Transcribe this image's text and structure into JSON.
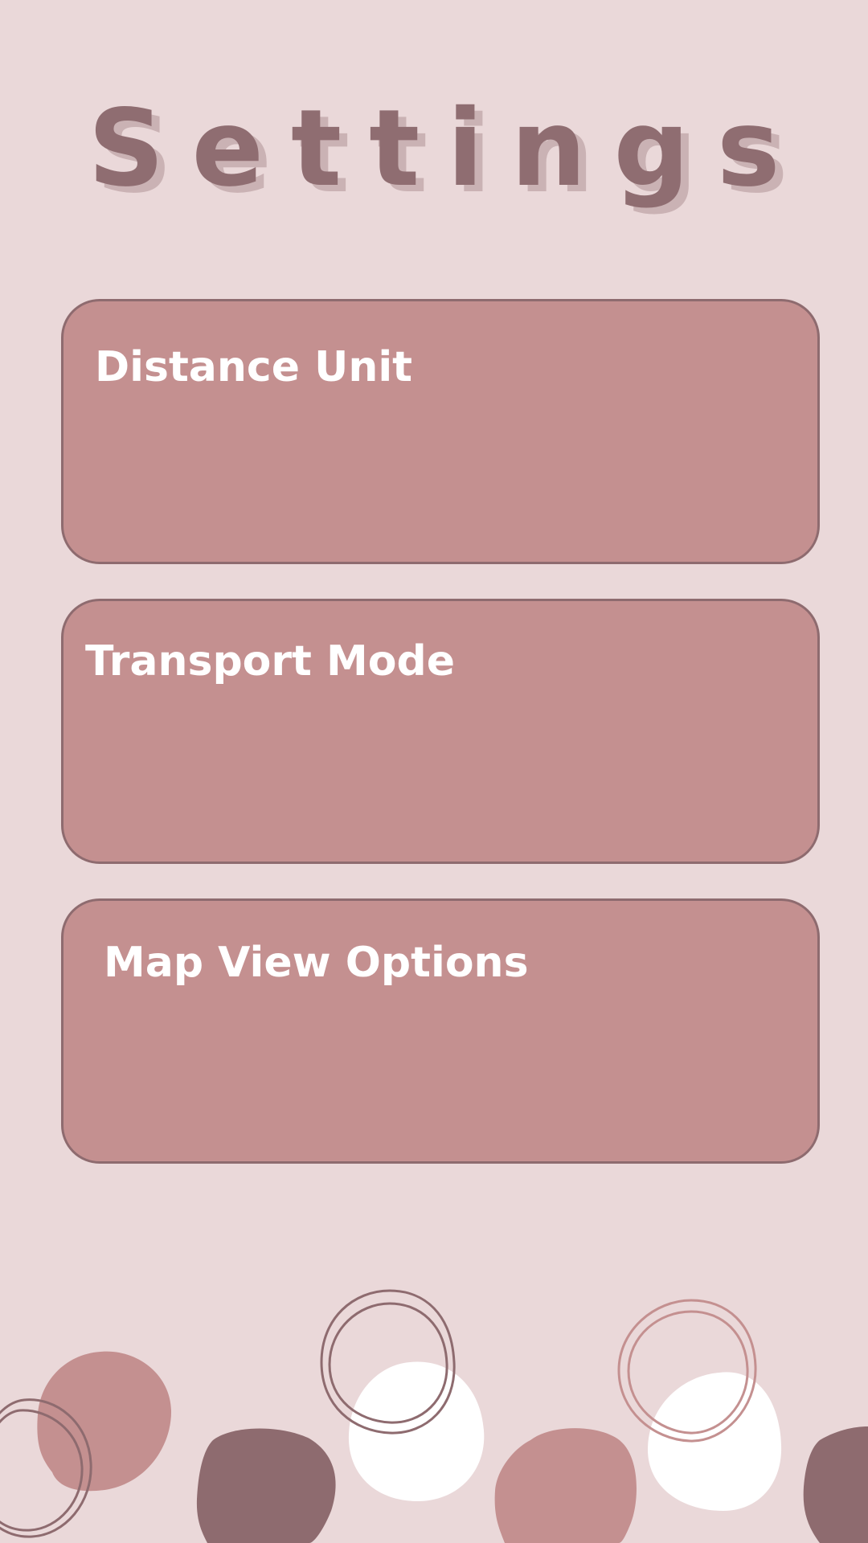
{
  "header": {
    "title": "Settings"
  },
  "settings": {
    "items": [
      {
        "label": "Distance Unit"
      },
      {
        "label": "Transport Mode"
      },
      {
        "label": "Map View Options"
      }
    ]
  },
  "theme": {
    "background": "#ead8d9",
    "card_fill": "#c49090",
    "card_border": "#8e6b6f",
    "title_color": "#8f6d71",
    "card_text": "#ffffff",
    "blob_dark": "#8e6b6f",
    "blob_rose": "#c49090",
    "blob_light": "#ffffff"
  }
}
